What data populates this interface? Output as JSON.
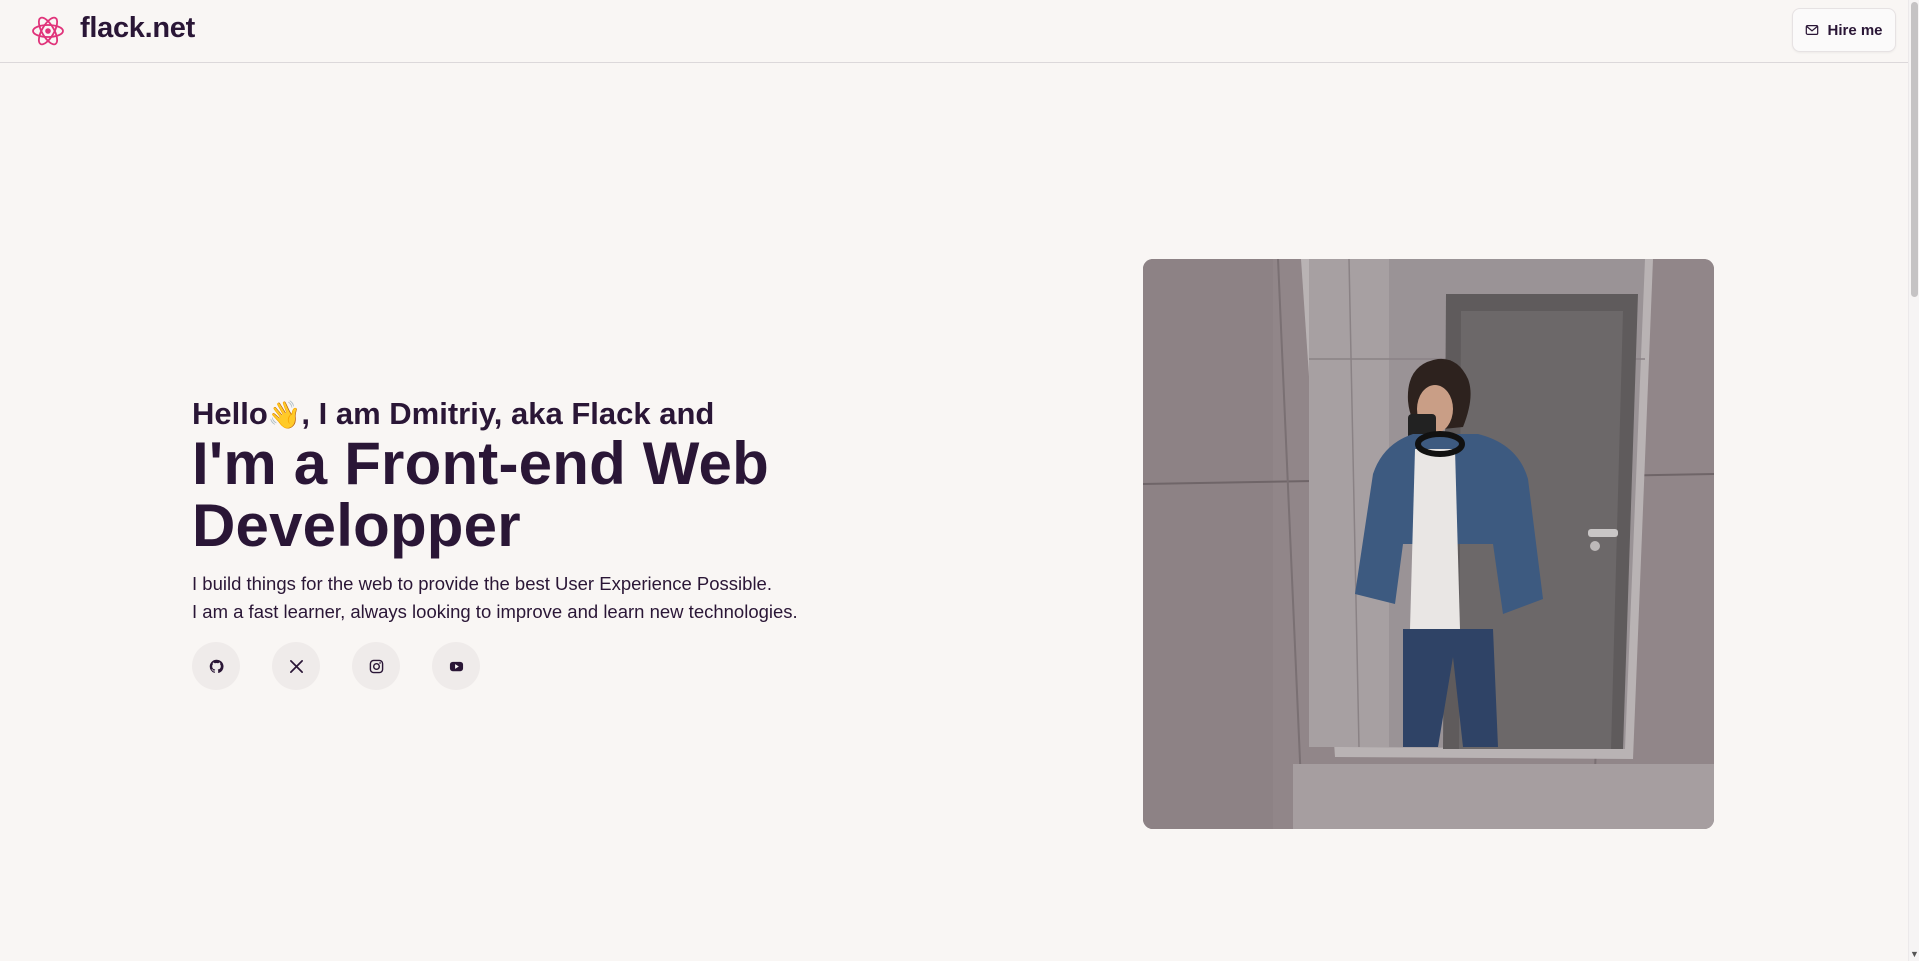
{
  "header": {
    "site_name": "flack.net",
    "logo_icon": "react-atom-icon",
    "hire_button": {
      "label": "Hire me",
      "icon": "mail-icon"
    }
  },
  "hero": {
    "greeting_before": "Hello",
    "greeting_emoji": "👋",
    "greeting_after": ", I am Dmitriy, aka Flack and",
    "headline": "I'm a Front-end Web Developper",
    "description_line1": "I build things for the web to provide the best User Experience Possible.",
    "description_line2": "I am a fast learner, always looking to improve and learn new technologies.",
    "socials": [
      {
        "name": "github",
        "icon": "github-icon"
      },
      {
        "name": "x",
        "icon": "x-icon"
      },
      {
        "name": "instagram",
        "icon": "instagram-icon"
      },
      {
        "name": "youtube",
        "icon": "youtube-icon"
      }
    ],
    "photo": "mirror-selfie-photo"
  },
  "colors": {
    "background": "#f9f6f4",
    "text": "#2a1636",
    "accent": "#e0337a",
    "social_bg": "#efebea"
  }
}
